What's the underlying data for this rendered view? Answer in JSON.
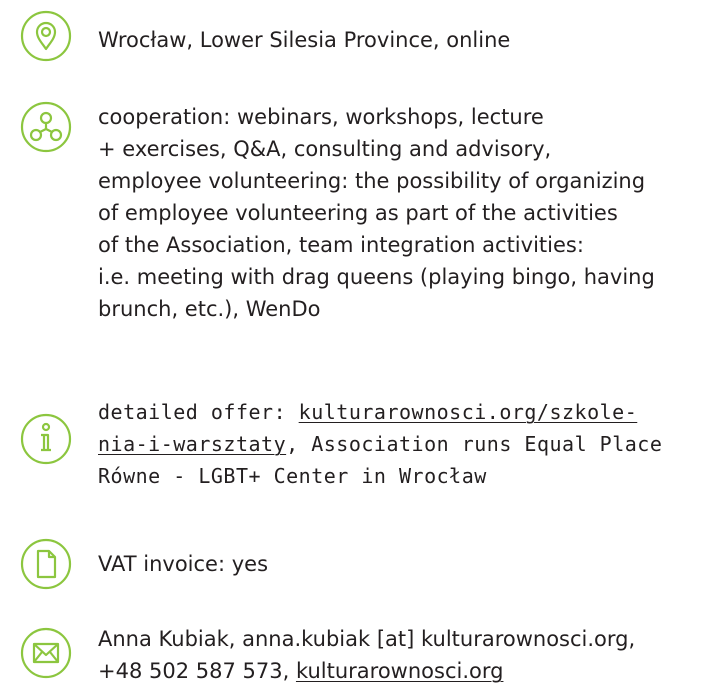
{
  "accent_color": "#8cc63f",
  "location": {
    "icon": "location-pin-icon",
    "text": "Wrocław, Lower Silesia Province, online"
  },
  "cooperation": {
    "icon": "network-nodes-icon",
    "lines": [
      "cooperation: webinars, workshops, lecture",
      "+ exercises, Q&A, consulting and advisory,",
      "employee volunteering: the possibility of organizing",
      "of employee volunteering as part of the activities",
      "of the Association, team integration activities:",
      "i.e. meeting with drag queens (playing bingo, having",
      "brunch, etc.), WenDo"
    ]
  },
  "offer": {
    "icon": "info-icon",
    "prefix": "detailed offer: ",
    "link_part1": "kulturarownosci.org/szkole-",
    "link_part2": "nia-i-warsztaty",
    "line2_rest": ", Association runs Equal Place",
    "line3": "Równe - LGBT+ Center in Wrocław"
  },
  "invoice": {
    "icon": "document-icon",
    "text": "VAT invoice: yes"
  },
  "contact": {
    "icon": "envelope-icon",
    "line1": "Anna Kubiak, anna.kubiak [at] kulturarownosci.org,",
    "line2_prefix": "+48 502 587 573, ",
    "website": "kulturarownosci.org"
  }
}
